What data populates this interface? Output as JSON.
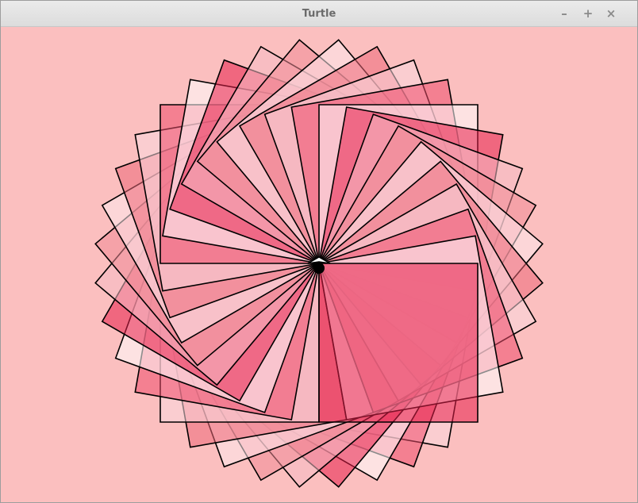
{
  "window": {
    "title": "Turtle",
    "buttons": {
      "minimize": "–",
      "maximize": "+",
      "close": "×"
    }
  },
  "canvas": {
    "background_color": "#fbbfbf",
    "drawing": {
      "shape": "square",
      "count": 36,
      "rotation_step_degrees": 10,
      "outline_color": "#000000",
      "fill_palette": [
        "#e81f4a",
        "#ffffff",
        "#ee4d6b",
        "#f9d9de",
        "#ec6879",
        "#fde9ec",
        "#f18a96",
        "#f6bcc4"
      ],
      "fill_opacity": 0.55
    },
    "turtle_cursor": {
      "shape": "classic-arrow",
      "color": "#000000",
      "fill": "#ffffff"
    }
  }
}
